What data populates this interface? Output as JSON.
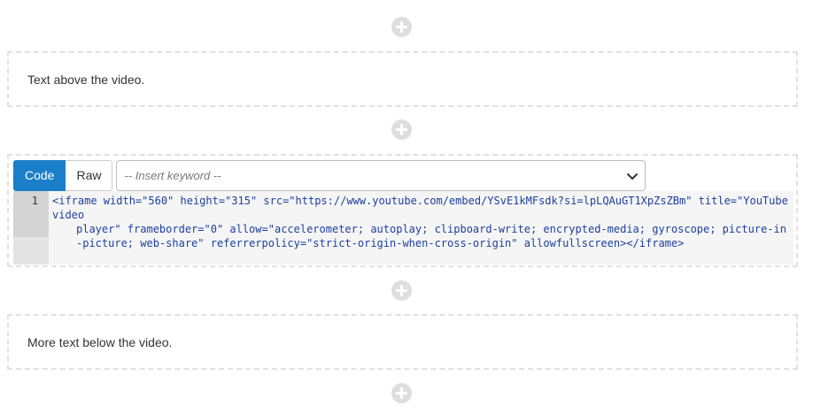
{
  "blocks": {
    "text_above": "Text above the video.",
    "text_below": "More text below the video."
  },
  "editor": {
    "tabs": {
      "code": "Code",
      "raw": "Raw"
    },
    "keyword_placeholder": "-- Insert keyword --",
    "line_number": "1",
    "code_line_1": "<iframe width=\"560\" height=\"315\" src=\"https://www.youtube.com/embed/YSvE1kMFsdk?si=lpLQAuGT1XpZsZBm\" title=\"YouTube video",
    "code_line_2": "player\" frameborder=\"0\" allow=\"accelerometer; autoplay; clipboard-write; encrypted-media; gyroscope; picture-in",
    "code_line_3": "-picture; web-share\" referrerpolicy=\"strict-origin-when-cross-origin\" allowfullscreen></iframe>"
  },
  "icons": {
    "add": "plus-circle-icon",
    "dropdown": "chevron-down-icon"
  },
  "colors": {
    "accent": "#1a7fc8",
    "add_button": "#dedede",
    "block_border": "#e1e1e1"
  }
}
